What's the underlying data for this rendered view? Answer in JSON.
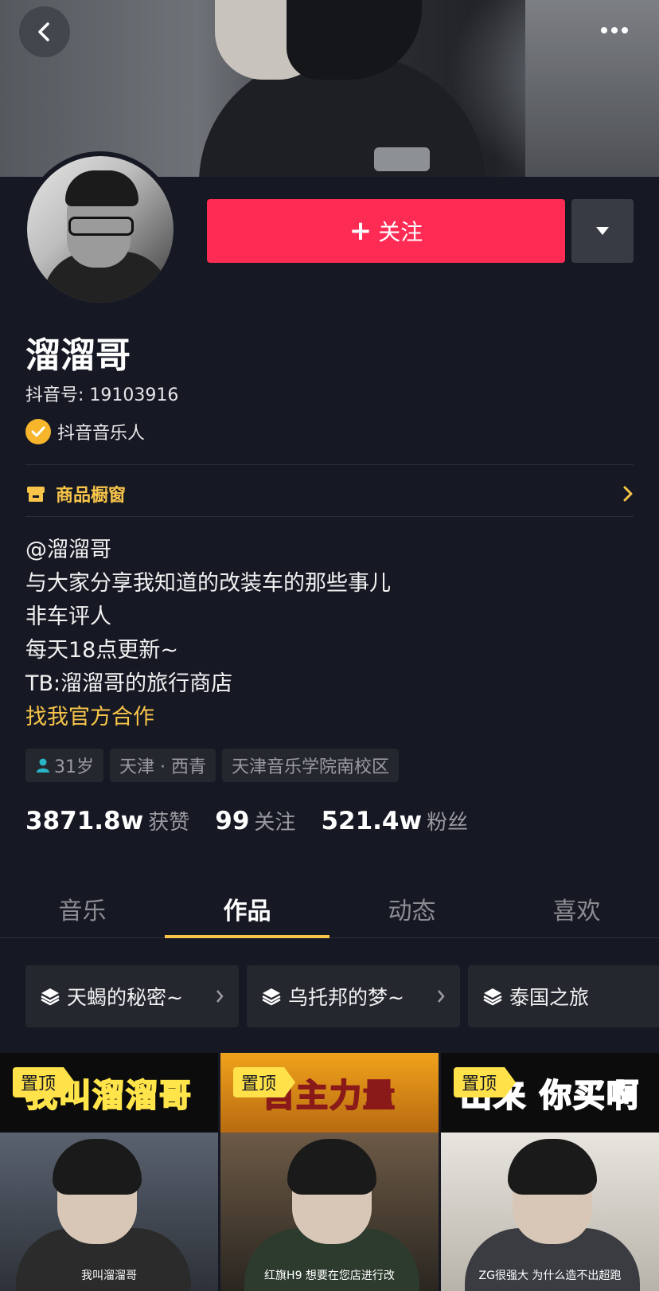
{
  "header": {
    "back_icon": "chevron-left-icon",
    "more_icon": "more-dots-icon"
  },
  "profile": {
    "follow_label": "关注",
    "name": "溜溜哥",
    "douyin_id": "抖音号: 19103916",
    "verified_label": "抖音音乐人",
    "shop_label": "商品橱窗",
    "bio": [
      "@溜溜哥",
      "与大家分享我知道的改装车的那些事儿",
      "非车评人",
      "每天18点更新~",
      "TB:溜溜哥的旅行商店"
    ],
    "bio_link": "找我官方合作",
    "tags": {
      "age": "31岁",
      "location": "天津 · 西青",
      "school": "天津音乐学院南校区"
    },
    "stats": [
      {
        "num": "3871.8w",
        "label": "获赞"
      },
      {
        "num": "99",
        "label": "关注"
      },
      {
        "num": "521.4w",
        "label": "粉丝"
      }
    ]
  },
  "tabs": [
    "音乐",
    "作品",
    "动态",
    "喜欢"
  ],
  "active_tab": "作品",
  "collections": [
    "天蝎的秘密~",
    "乌托邦的梦~",
    "泰国之旅"
  ],
  "videos": [
    {
      "pin": "置顶",
      "title": "我叫溜溜哥",
      "subtitle": "我叫溜溜哥"
    },
    {
      "pin": "置顶",
      "title": "自主力量",
      "subtitle": "红旗H9 想要在您店进行改"
    },
    {
      "pin": "置顶",
      "title": "出来 你买啊",
      "subtitle": "ZG很强大 为什么造不出超跑"
    }
  ],
  "colors": {
    "accent": "#fe2c55",
    "gold": "#f8c54a",
    "bg": "#161823"
  }
}
